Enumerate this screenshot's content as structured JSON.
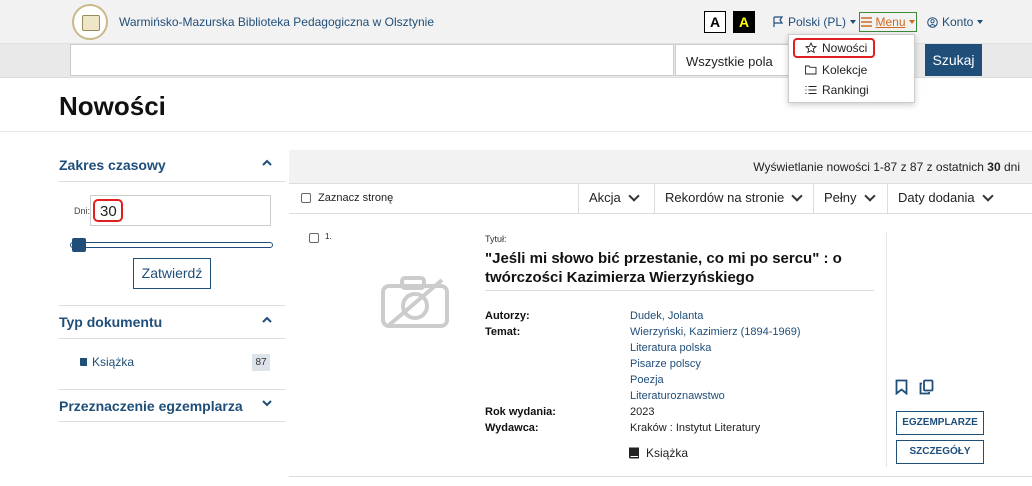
{
  "header": {
    "site_title": "Warmińsko-Mazurska Biblioteka Pedagogiczna w Olsztynie",
    "contrast_normal": "A",
    "contrast_high": "A",
    "language": "Polski (PL)",
    "menu": "Menu",
    "account": "Konto"
  },
  "search": {
    "value": "",
    "field": "Wszystkie pola",
    "button": "Szukaj"
  },
  "menu_dropdown": {
    "items": [
      {
        "label": "Nowości",
        "icon": "star-icon"
      },
      {
        "label": "Kolekcje",
        "icon": "folder-icon"
      },
      {
        "label": "Rankingi",
        "icon": "list-icon"
      }
    ]
  },
  "page": {
    "title": "Nowości"
  },
  "sidebar": {
    "time_range": {
      "title": "Zakres czasowy",
      "days_label": "Dni:",
      "days_value": "30",
      "confirm": "Zatwierdź"
    },
    "doc_type": {
      "title": "Typ dokumentu",
      "items": [
        {
          "label": "Książka",
          "count": "87"
        }
      ]
    },
    "purpose": {
      "title": "Przeznaczenie egzemplarza"
    }
  },
  "results": {
    "summary_prefix": "Wyświetlanie nowości 1-87 z 87 z ostatnich ",
    "summary_days": "30",
    "summary_suffix": " dni",
    "select_page": "Zaznacz stronę",
    "toolbar": {
      "action": "Akcja",
      "per_page": "Rekordów na stronie",
      "view": "Pełny",
      "sort": "Daty dodania"
    }
  },
  "record": {
    "number": "1.",
    "title_label": "Tytuł:",
    "title": "\"Jeśli mi słowo bić przestanie, co mi po sercu\" : o twórczości Kazimierza Wierzyńskiego",
    "authors_label": "Autorzy:",
    "author": "Dudek, Jolanta",
    "subject_label": "Temat:",
    "subjects": [
      "Wierzyński, Kazimierz (1894-1969)",
      "Literatura polska",
      "Pisarze polscy",
      "Poezja",
      "Literaturoznawstwo"
    ],
    "year_label": "Rok wydania:",
    "year": "2023",
    "publisher_label": "Wydawca:",
    "publisher": "Kraków : Instytut Literatury",
    "type": "Książka",
    "copies_button": "EGZEMPLARZE",
    "details_button": "SZCZEGÓŁY"
  },
  "colors": {
    "primary": "#1f4e79",
    "highlight": "#e02020",
    "menu_text": "#d2691e"
  }
}
